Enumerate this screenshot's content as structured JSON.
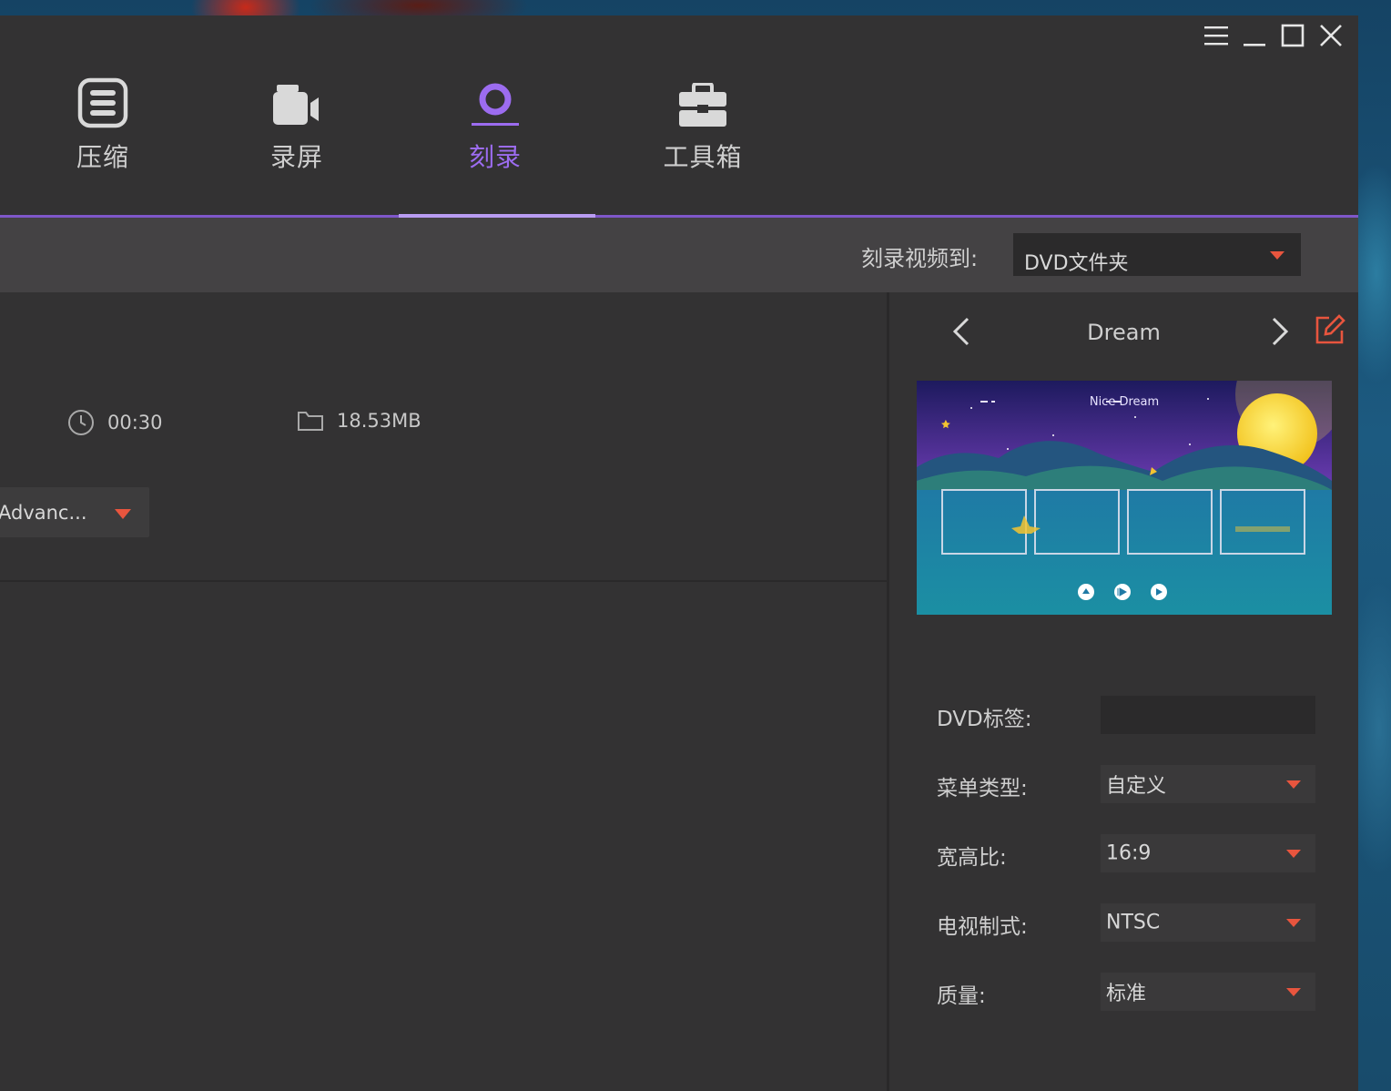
{
  "window_controls": {
    "menu_icon": "hamburger-icon",
    "minimize_icon": "minimize-icon",
    "maximize_icon": "maximize-icon",
    "close_icon": "close-icon"
  },
  "nav": {
    "items": [
      {
        "label": "压缩",
        "icon": "compress-icon"
      },
      {
        "label": "录屏",
        "icon": "video-camera-icon"
      },
      {
        "label": "刻录",
        "icon": "disc-icon"
      },
      {
        "label": "工具箱",
        "icon": "toolbox-icon"
      }
    ],
    "active": "刻录",
    "accent_color": "#9c6cf0"
  },
  "burn_bar": {
    "label": "刻录视频到:",
    "target": "DVD文件夹"
  },
  "file": {
    "duration": "00:30",
    "size": "18.53MB",
    "preset": "Advanc..."
  },
  "template": {
    "name": "Dream",
    "thumbnail_title": "Nice Dream"
  },
  "settings": {
    "dvd_label": {
      "label": "DVD标签:",
      "value": ""
    },
    "menu_type": {
      "label": "菜单类型:",
      "value": "自定义"
    },
    "aspect_ratio": {
      "label": "宽高比:",
      "value": "16:9"
    },
    "tv_standard": {
      "label": "电视制式:",
      "value": "NTSC"
    },
    "quality": {
      "label": "质量:",
      "value": "标准"
    }
  },
  "colors": {
    "caret": "#e8553e",
    "edit_icon": "#e8553e",
    "background": "#333233"
  }
}
